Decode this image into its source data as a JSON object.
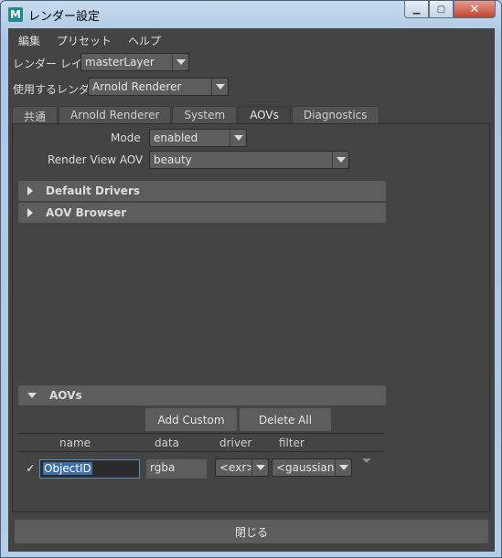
{
  "window": {
    "icon_letter": "M",
    "title": "レンダー設定",
    "min_glyph": "▁",
    "max_glyph": "▢",
    "close_glyph": "✕"
  },
  "menu": {
    "items": [
      "編集",
      "プリセット",
      "ヘルプ"
    ]
  },
  "render_layer": {
    "label": "レンダー レイヤ",
    "value": "masterLayer"
  },
  "renderer": {
    "label": "使用するレンダラ",
    "value": "Arnold Renderer"
  },
  "tabs": [
    "共通",
    "Arnold Renderer",
    "System",
    "AOVs",
    "Diagnostics"
  ],
  "active_tab": "AOVs",
  "mode": {
    "label": "Mode",
    "value": "enabled"
  },
  "render_view_aov": {
    "label": "Render View AOV",
    "value": "beauty"
  },
  "sections": {
    "default_drivers": "Default Drivers",
    "aov_browser": "AOV Browser",
    "aovs": "AOVs"
  },
  "aov_buttons": {
    "add_custom": "Add Custom",
    "delete_all": "Delete All"
  },
  "aov_table": {
    "headers": [
      "name",
      "data",
      "driver",
      "filter"
    ],
    "rows": [
      {
        "checked": "✓",
        "name": "ObjectID",
        "data": "rgba",
        "driver": "<exr>",
        "filter": "<gaussian>"
      }
    ]
  },
  "footer": {
    "close_label": "閉じる"
  },
  "colors": {
    "panel_bg": "#444444",
    "control_bg": "#5d5d5d",
    "selection": "#3d6ea8"
  }
}
